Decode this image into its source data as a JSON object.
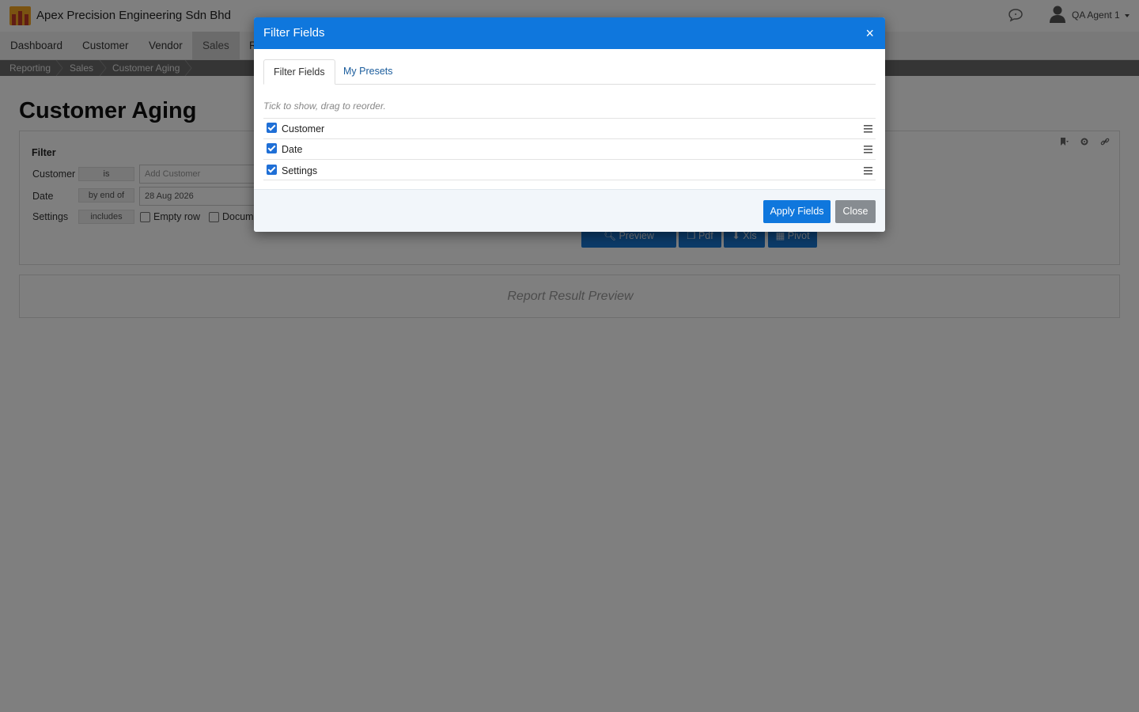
{
  "app": {
    "company_name": "Apex Precision Engineering Sdn Bhd",
    "user_name": "QA Agent 1",
    "brand_color": "#1976d2"
  },
  "nav": {
    "items": [
      {
        "label": "Dashboard"
      },
      {
        "label": "Customer"
      },
      {
        "label": "Vendor"
      },
      {
        "label": "Sales"
      },
      {
        "label": "R"
      }
    ],
    "active": "Sales"
  },
  "breadcrumb": [
    "Reporting",
    "Sales",
    "Customer Aging"
  ],
  "page": {
    "title": "Customer Aging"
  },
  "filter": {
    "heading": "Filter",
    "rows": [
      {
        "label": "Customer",
        "operator": "is",
        "value": "",
        "placeholder": "Add Customer"
      },
      {
        "label": "Date",
        "operator": "by end of",
        "value": "28 Aug 2026"
      },
      {
        "label": "Settings",
        "operator": "includes",
        "options": [
          "Empty row",
          "Docume"
        ]
      }
    ],
    "buttons": {
      "preview": "Preview",
      "pdf": "Pdf",
      "xls": "Xls",
      "pivot": "Pivot"
    }
  },
  "result": {
    "placeholder": "Report Result Preview"
  },
  "modal": {
    "title": "Filter Fields",
    "close_symbol": "×",
    "tabs": [
      "Filter Fields",
      "My Presets"
    ],
    "active_tab": "Filter Fields",
    "hint": "Tick to show, drag to reorder.",
    "fields": [
      {
        "label": "Customer",
        "checked": true
      },
      {
        "label": "Date",
        "checked": true
      },
      {
        "label": "Settings",
        "checked": true
      }
    ],
    "apply_label": "Apply Fields",
    "close_label": "Close"
  }
}
